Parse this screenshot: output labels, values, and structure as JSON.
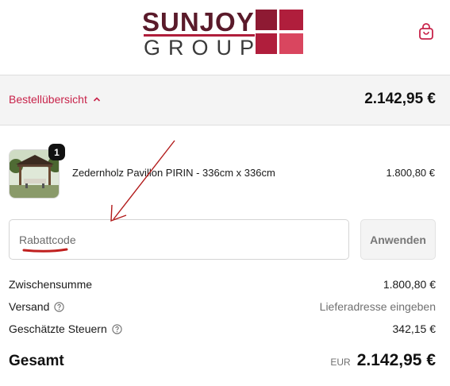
{
  "brand": {
    "logo_top": "SUNJOY",
    "logo_bottom": "GROUP"
  },
  "header": {
    "cart_icon": "shopping-bag-icon"
  },
  "summary": {
    "toggle_label": "Bestellübersicht",
    "total": "2.142,95 €"
  },
  "product": {
    "quantity": "1",
    "name": "Zedernholz Pavillon PIRIN - 336cm x 336cm",
    "price": "1.800,80 €"
  },
  "discount": {
    "placeholder": "Rabattcode",
    "apply_label": "Anwenden"
  },
  "costs": {
    "subtotal_label": "Zwischensumme",
    "subtotal_value": "1.800,80 €",
    "shipping_label": "Versand",
    "shipping_value": "Lieferadresse eingeben",
    "tax_label": "Geschätzte Steuern",
    "tax_value": "342,15 €"
  },
  "total": {
    "label": "Gesamt",
    "currency": "EUR",
    "amount": "2.142,95 €"
  },
  "colors": {
    "accent": "#c8234a",
    "annotation": "#b21a1a"
  }
}
